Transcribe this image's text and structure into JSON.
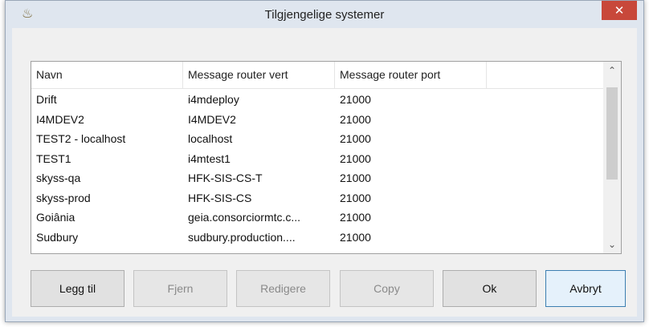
{
  "window": {
    "title": "Tilgjengelige systemer",
    "close_symbol": "✕",
    "app_icon": "♨"
  },
  "table": {
    "columns": [
      "Navn",
      "Message router vert",
      "Message router port"
    ],
    "rows": [
      [
        "Drift",
        "i4mdeploy",
        "21000"
      ],
      [
        "I4MDEV2",
        "I4MDEV2",
        "21000"
      ],
      [
        "TEST2 - localhost",
        "localhost",
        "21000"
      ],
      [
        "TEST1",
        "i4mtest1",
        "21000"
      ],
      [
        "skyss-qa",
        "HFK-SIS-CS-T",
        "21000"
      ],
      [
        "skyss-prod",
        "HFK-SIS-CS",
        "21000"
      ],
      [
        "Goiânia",
        "geia.consorciormtc.c...",
        "21000"
      ],
      [
        "Sudbury",
        "sudbury.production....",
        "21000"
      ]
    ],
    "scroll_up": "⌃",
    "scroll_down": "⌄"
  },
  "buttons": {
    "add": "Legg til",
    "remove": "Fjern",
    "edit": "Redigere",
    "copy": "Copy",
    "ok": "Ok",
    "cancel": "Avbryt"
  }
}
